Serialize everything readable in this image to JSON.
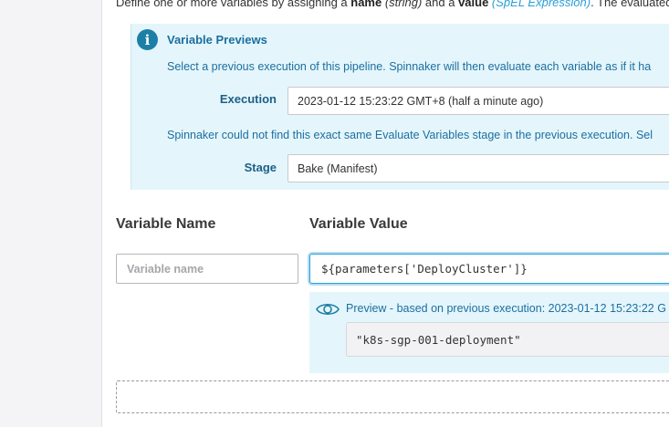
{
  "intro": {
    "prefix": "Define one or more variables by assigning a ",
    "name_word": "name",
    "name_type": " (string)",
    "middle": " and a ",
    "value_word": "value",
    "value_type": " (SpEL Expression)",
    "suffix": ". The evaluated v"
  },
  "previews": {
    "title": "Variable Previews",
    "description": "Select a previous execution of this pipeline. Spinnaker will then evaluate each variable as if it ha",
    "execution_label": "Execution",
    "execution_value": "2023-01-12 15:23:22 GMT+8 (half a minute ago)",
    "not_found_text": "Spinnaker could not find this exact same Evaluate Variables stage in the previous execution. Sel",
    "stage_label": "Stage",
    "stage_value": "Bake (Manifest)"
  },
  "variables": {
    "name_header": "Variable Name",
    "value_header": "Variable Value",
    "name_placeholder": "Variable name",
    "value": "${parameters['DeployCluster']}"
  },
  "expression_preview": {
    "label": "Preview - based on previous execution: 2023-01-12 15:23:22 G",
    "result": "\"k8s-sgp-001-deployment\""
  },
  "colors": {
    "accent": "#2a9fd6",
    "panel_bg": "#e4f6fb",
    "panel_text": "#1d6ea0"
  }
}
